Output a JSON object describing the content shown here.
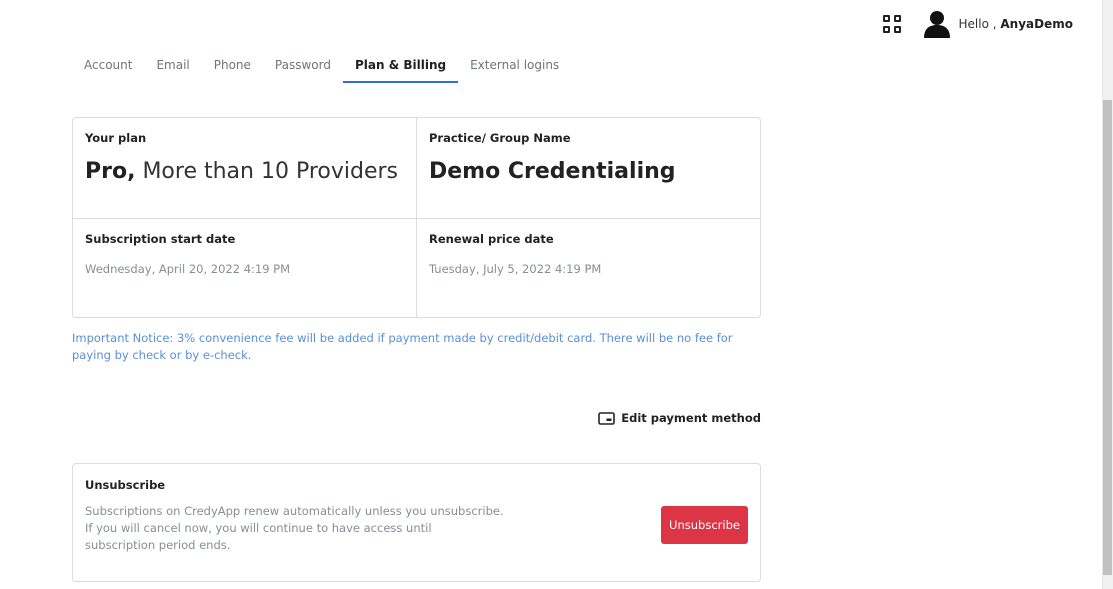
{
  "header": {
    "greeting": "Hello ,",
    "username": "AnyaDemo"
  },
  "tabs": [
    {
      "label": "Account"
    },
    {
      "label": "Email"
    },
    {
      "label": "Phone"
    },
    {
      "label": "Password"
    },
    {
      "label": "Plan & Billing"
    },
    {
      "label": "External logins"
    }
  ],
  "plan": {
    "label": "Your plan",
    "tier": "Pro,",
    "description": "More than 10 Providers"
  },
  "group": {
    "label": "Practice/ Group Name",
    "value": "Demo Credentialing"
  },
  "subscription_start": {
    "label": "Subscription start date",
    "value": "Wednesday, April 20, 2022 4:19 PM"
  },
  "renewal": {
    "label": "Renewal price date",
    "value": "Tuesday, July 5, 2022 4:19 PM"
  },
  "notice": "Important Notice: 3% convenience fee will be added if payment made by credit/debit card. There will be no fee for paying by check or by e-check.",
  "edit_payment_label": "Edit payment method",
  "unsubscribe": {
    "title": "Unsubscribe",
    "line1": "Subscriptions on CredyApp renew automatically unless you unsubscribe.",
    "line2": "If you will cancel now, you will continue to have access until",
    "line3": "subscription period ends.",
    "button_label": "Unsubscribe"
  },
  "colors": {
    "accent": "#2e6fd8",
    "notice": "#5a8fd6",
    "danger": "#dc3545"
  },
  "icons": {
    "apps": "grid-icon",
    "avatar": "user-avatar-icon",
    "payment": "credit-card-icon"
  }
}
